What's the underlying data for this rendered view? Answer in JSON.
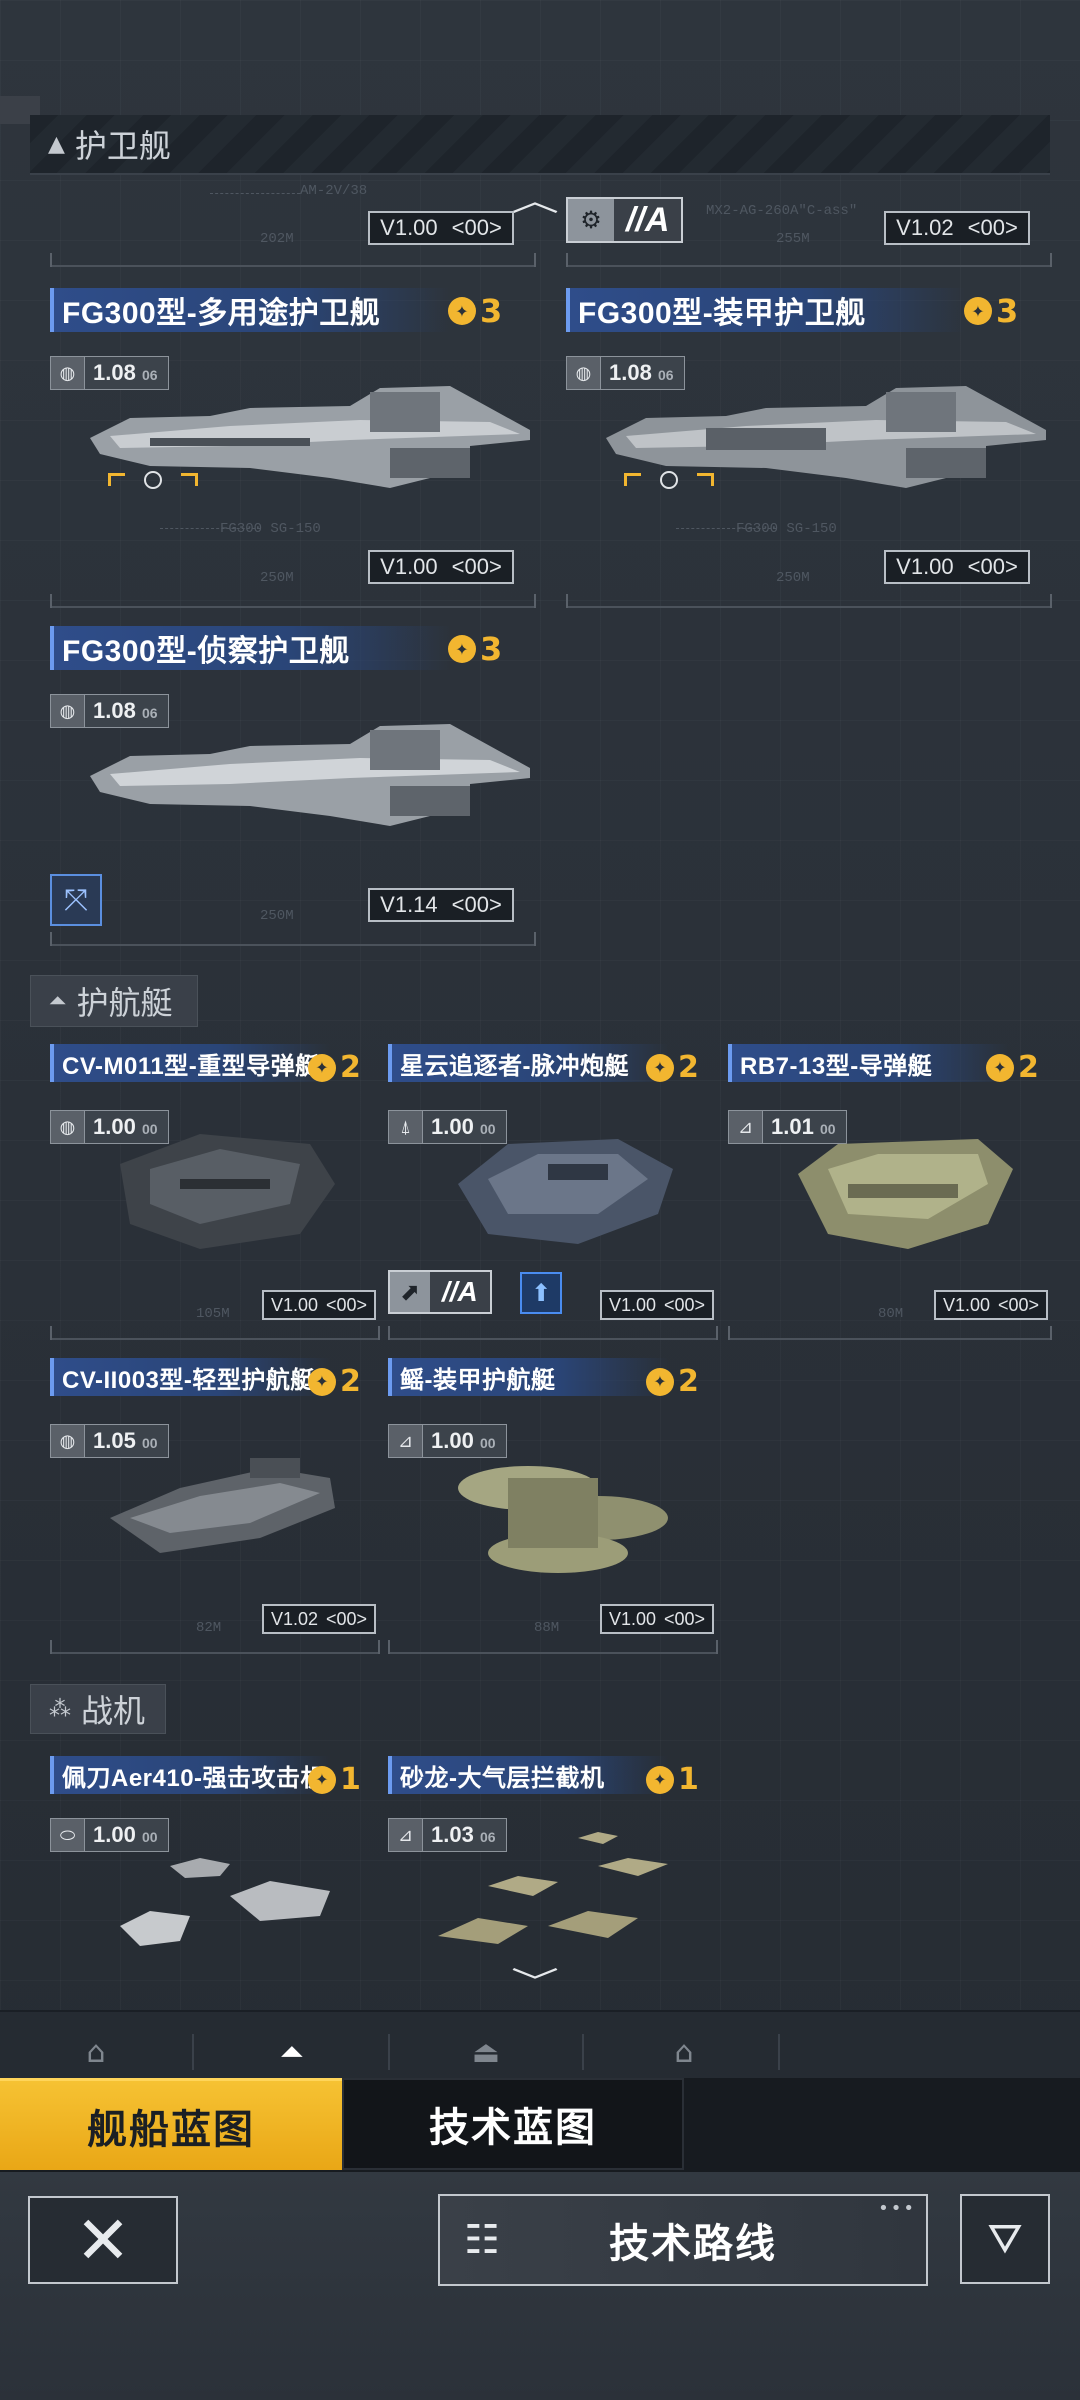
{
  "sections": {
    "frigate": {
      "label": "护卫舰",
      "icon": "▲"
    },
    "destroyer": {
      "label": "护航艇",
      "icon": "⏶"
    },
    "fighter": {
      "label": "战机",
      "icon": "⁂"
    }
  },
  "partial_row": {
    "left": {
      "caption": "AM-2V/38",
      "length": "202M",
      "version": "V1.00",
      "code": "<00>"
    },
    "right": {
      "caption": "MX2-AG-260A\"C-ass\"",
      "length": "255M",
      "version": "V1.02",
      "code": "<00>",
      "badge_letter": "//A"
    }
  },
  "frigates": [
    {
      "name": "FG300型-多用途护卫舰",
      "rank": "3",
      "faction_val": "1.08",
      "faction_sub": "06",
      "length": "250M",
      "caption": "FG300 SG-150",
      "version": "V1.00",
      "code": "<00>"
    },
    {
      "name": "FG300型-装甲护卫舰",
      "rank": "3",
      "faction_val": "1.08",
      "faction_sub": "06",
      "length": "250M",
      "caption": "FG300 SG-150",
      "version": "V1.00",
      "code": "<00>"
    },
    {
      "name": "FG300型-侦察护卫舰",
      "rank": "3",
      "faction_val": "1.08",
      "faction_sub": "06",
      "length": "250M",
      "version": "V1.14",
      "code": "<00>"
    }
  ],
  "destroyers": [
    {
      "name": "CV-M011型-重型导弹艇",
      "rank": "2",
      "faction_val": "1.00",
      "faction_sub": "00",
      "length": "105M",
      "version": "V1.00",
      "code": "<00>"
    },
    {
      "name": "星云追逐者-脉冲炮艇",
      "rank": "2",
      "faction_val": "1.00",
      "faction_sub": "00",
      "version": "V1.00",
      "code": "<00>",
      "badge_letter": "//A"
    },
    {
      "name": "RB7-13型-导弹艇",
      "rank": "2",
      "faction_val": "1.01",
      "faction_sub": "00",
      "length": "80M",
      "version": "V1.00",
      "code": "<00>"
    },
    {
      "name": "CV-II003型-轻型护航艇",
      "rank": "2",
      "faction_val": "1.05",
      "faction_sub": "00",
      "length": "82M",
      "version": "V1.02",
      "code": "<00>"
    },
    {
      "name": "鳐-装甲护航艇",
      "rank": "2",
      "faction_val": "1.00",
      "faction_sub": "00",
      "length": "88M",
      "version": "V1.00",
      "code": "<00>"
    }
  ],
  "fighters": [
    {
      "name": "佩刀Aer410-强击攻击机",
      "rank": "1",
      "faction_val": "1.00",
      "faction_sub": "00"
    },
    {
      "name": "砂龙-大气层拦截机",
      "rank": "1",
      "faction_val": "1.03",
      "faction_sub": "06"
    }
  ],
  "bp_tabs": {
    "ship": "舰船蓝图",
    "tech": "技术蓝图"
  },
  "buttons": {
    "route": "技术路线"
  },
  "colors": {
    "accent_gold": "#f2b630",
    "title_blue": "#2f4d8a",
    "bg": "#2a3139"
  }
}
